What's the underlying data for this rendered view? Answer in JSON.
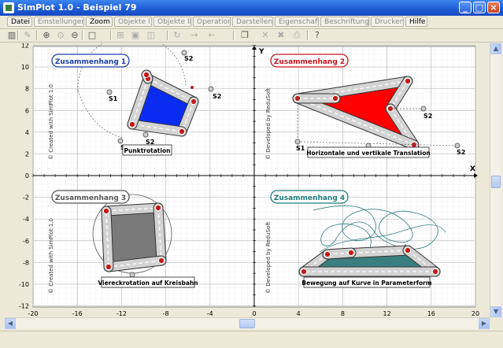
{
  "window": {
    "title": "SimPlot 1.0 - Beispiel 79"
  },
  "menu": [
    {
      "label": "Datei",
      "enabled": true
    },
    {
      "label": "Einstellungen",
      "enabled": false
    },
    {
      "label": "Zoom",
      "enabled": true
    },
    {
      "label": "Objekte I",
      "enabled": false
    },
    {
      "label": "Objekte II",
      "enabled": false
    },
    {
      "label": "Operation",
      "enabled": false
    },
    {
      "label": "Darstellen",
      "enabled": false
    },
    {
      "label": "Eigenschaft",
      "enabled": false
    },
    {
      "label": "Beschriftung",
      "enabled": false
    },
    {
      "label": "Drucken",
      "enabled": false
    },
    {
      "label": "Hilfe",
      "enabled": true
    }
  ],
  "toolbar": [
    {
      "name": "calculator-icon",
      "glyph": "▥",
      "enabled": true
    },
    {
      "name": "pen-icon",
      "glyph": "✎",
      "enabled": false
    },
    {
      "name": "zoom-in-icon",
      "glyph": "⊕",
      "enabled": true
    },
    {
      "name": "zoom-icon",
      "glyph": "⊙",
      "enabled": false
    },
    {
      "name": "zoom-out-icon",
      "glyph": "⊖",
      "enabled": true
    },
    {
      "name": "square-icon",
      "glyph": "□",
      "enabled": true
    },
    {
      "name": "grid-icon",
      "glyph": "⊞",
      "enabled": false
    },
    {
      "name": "frame-icon",
      "glyph": "▣",
      "enabled": false
    },
    {
      "name": "box-icon",
      "glyph": "◫",
      "enabled": false
    },
    {
      "name": "rotate-icon",
      "glyph": "↻",
      "enabled": false
    },
    {
      "name": "arrow-right-icon",
      "glyph": "→",
      "enabled": false
    },
    {
      "name": "arrow-left-icon",
      "glyph": "←",
      "enabled": false
    },
    {
      "name": "copy-icon",
      "glyph": "❐",
      "enabled": true
    },
    {
      "name": "cut-icon",
      "glyph": "✕",
      "enabled": false
    },
    {
      "name": "delete-icon",
      "glyph": "✖",
      "enabled": false
    },
    {
      "name": "print-icon",
      "glyph": "⎙",
      "enabled": false
    },
    {
      "name": "help-icon",
      "glyph": "?",
      "enabled": true
    }
  ],
  "plot": {
    "axis_x_label": "X",
    "axis_y_label": "Y",
    "x_ticks": [
      "-20",
      "-16",
      "-12",
      "-8",
      "-4",
      "0",
      "4",
      "8",
      "12",
      "16",
      "20"
    ],
    "y_ticks": [
      "12",
      "10",
      "8",
      "6",
      "4",
      "2",
      "0",
      "-2",
      "-4",
      "-6",
      "-8",
      "-10",
      "-12"
    ],
    "watermark_left": "© Created with SimPlot 1.0",
    "watermark_right": "© Developed by ReduSoft",
    "panels": [
      {
        "title": "Zusammenhang 1",
        "title_color": "#1a3da8",
        "caption": "Punktrotation"
      },
      {
        "title": "Zusammenhang 2",
        "title_color": "#c8141e",
        "caption": "Horizontale und vertikale Translation"
      },
      {
        "title": "Zusammenhang 3",
        "title_color": "#555555",
        "caption": "Viereckrotation auf Kreisbahn"
      },
      {
        "title": "Zusammenhang 4",
        "title_color": "#1e7a7a",
        "caption": "Bewegung auf Kurve in Parameterform"
      }
    ],
    "point_labels": {
      "s1": "S1",
      "s2": "S2",
      "s": "S"
    },
    "colors": {
      "blue_fill": "#0a2cf0",
      "red_fill": "#ff0000",
      "gray_fill": "#7a7a7a",
      "teal_fill": "#3a7f7f",
      "vertex": "#c41818",
      "bar": "#d3d3d3"
    }
  },
  "status": {}
}
